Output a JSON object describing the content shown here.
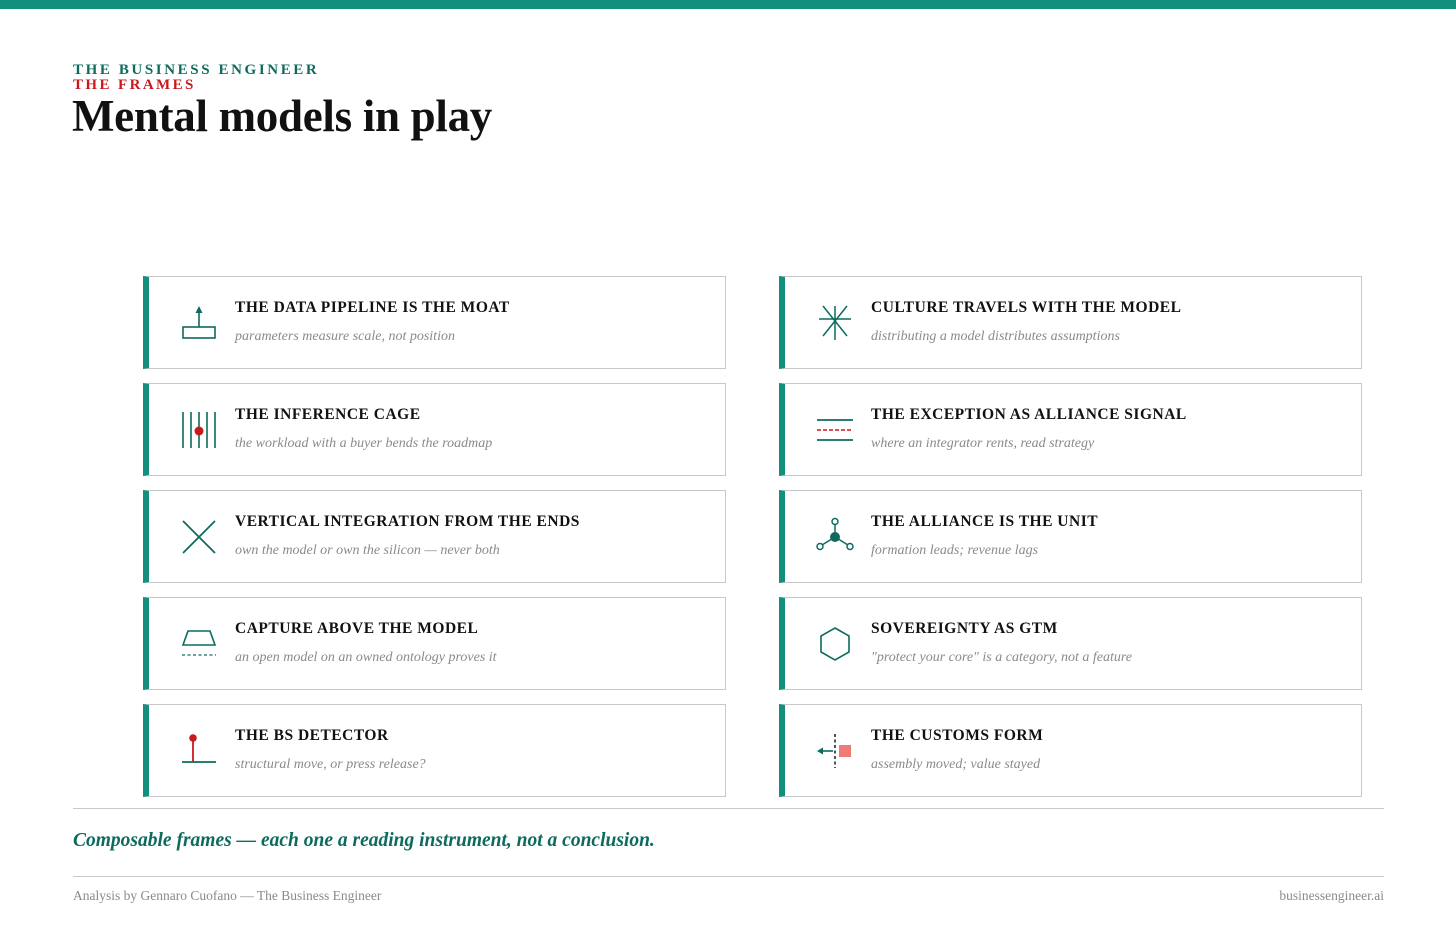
{
  "header": {
    "brand": "THE BUSINESS ENGINEER",
    "section": "THE FRAMES",
    "title": "Mental models in play"
  },
  "colors": {
    "accent": "#128f7d",
    "accent_dark": "#0d6b5e",
    "highlight": "#c8191f",
    "highlight_soft": "#ef7a78"
  },
  "frames": [
    {
      "icon": "upload-base-icon",
      "heading": "THE DATA PIPELINE IS THE MOAT",
      "subtitle": "parameters measure scale, not position"
    },
    {
      "icon": "cage-bars-icon",
      "heading": "THE INFERENCE CAGE",
      "subtitle": "the workload with a buyer bends the roadmap"
    },
    {
      "icon": "cross-icon",
      "heading": "VERTICAL INTEGRATION FROM THE ENDS",
      "subtitle": "own the model or own the silicon — never both"
    },
    {
      "icon": "trapezoid-layer-icon",
      "heading": "CAPTURE ABOVE THE MODEL",
      "subtitle": "an open model on an owned ontology proves it"
    },
    {
      "icon": "pin-detector-icon",
      "heading": "THE BS DETECTOR",
      "subtitle": "structural move, or press release?"
    },
    {
      "icon": "asterisk-icon",
      "heading": "CULTURE TRAVELS WITH THE MODEL",
      "subtitle": "distributing a model distributes assumptions"
    },
    {
      "icon": "dashed-lines-icon",
      "heading": "THE EXCEPTION AS ALLIANCE SIGNAL",
      "subtitle": "where an integrator rents, read strategy"
    },
    {
      "icon": "node-network-icon",
      "heading": "THE ALLIANCE IS THE UNIT",
      "subtitle": "formation leads; revenue lags"
    },
    {
      "icon": "hexagon-icon",
      "heading": "SOVEREIGNTY AS GTM",
      "subtitle": "\"protect your core\" is a category, not a feature"
    },
    {
      "icon": "customs-border-icon",
      "heading": "THE CUSTOMS FORM",
      "subtitle": "assembly moved; value stayed"
    }
  ],
  "tagline": "Composable frames — each one a reading instrument, not a conclusion.",
  "footer": {
    "credit": "Analysis by Gennaro Cuofano — The Business Engineer",
    "site": "businessengineer.ai"
  }
}
